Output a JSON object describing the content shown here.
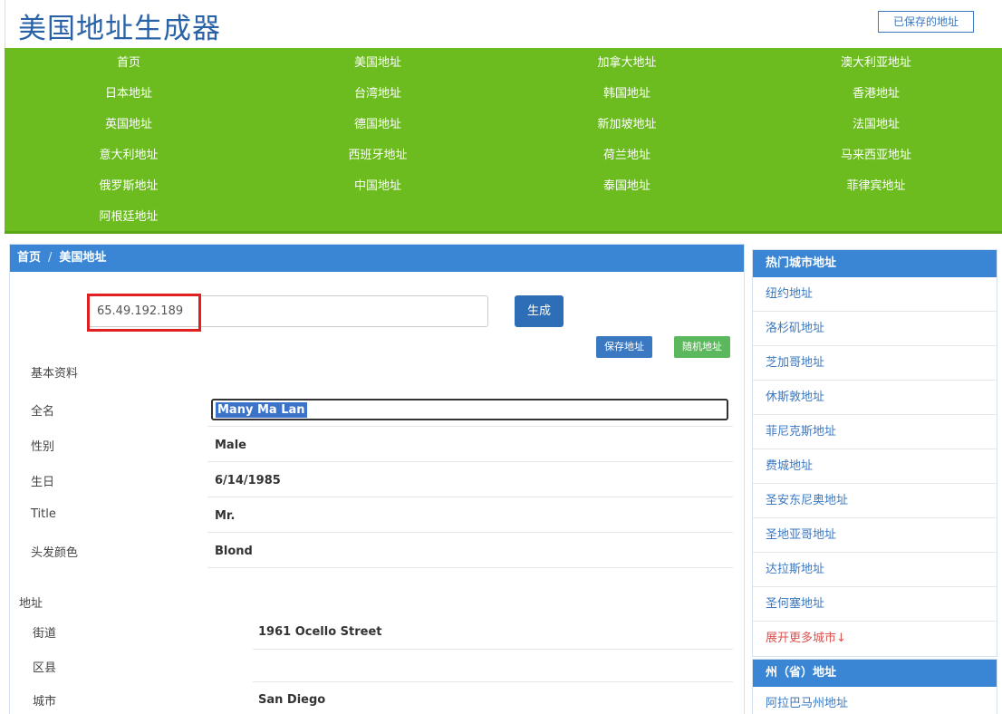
{
  "header": {
    "logo": "美国地址生成器",
    "saved_button": "已保存的地址"
  },
  "nav": [
    [
      "首页",
      "美国地址",
      "加拿大地址",
      "澳大利亚地址"
    ],
    [
      "日本地址",
      "台湾地址",
      "韩国地址",
      "香港地址"
    ],
    [
      "英国地址",
      "德国地址",
      "新加坡地址",
      "法国地址"
    ],
    [
      "意大利地址",
      "西班牙地址",
      "荷兰地址",
      "马来西亚地址"
    ],
    [
      "俄罗斯地址",
      "中国地址",
      "泰国地址",
      "菲律宾地址"
    ],
    [
      "阿根廷地址"
    ]
  ],
  "breadcrumb": {
    "home": "首页",
    "sep": "/",
    "current": "美国地址"
  },
  "ip_input": {
    "value": "65.49.192.189"
  },
  "buttons": {
    "generate": "生成",
    "save_address": "保存地址",
    "random_address": "随机地址"
  },
  "basic_info": {
    "title": "基本资料",
    "rows": [
      {
        "label": "全名",
        "value": "Many Ma Lan"
      },
      {
        "label": "性别",
        "value": "Male"
      },
      {
        "label": "生日",
        "value": "6/14/1985"
      },
      {
        "label": "Title",
        "value": "Mr."
      },
      {
        "label": "头发颜色",
        "value": "Blond"
      }
    ]
  },
  "address": {
    "title": "地址",
    "rows": [
      {
        "label": "街道",
        "value": "1961  Ocello Street"
      },
      {
        "label": "区县",
        "value": ""
      },
      {
        "label": "城市",
        "value": "San Diego"
      }
    ]
  },
  "sidebar": {
    "hot_cities_title": "热门城市地址",
    "hot_cities": [
      "纽约地址",
      "洛杉矶地址",
      "芝加哥地址",
      "休斯敦地址",
      "菲尼克斯地址",
      "费城地址",
      "圣安东尼奥地址",
      "圣地亚哥地址",
      "达拉斯地址",
      "圣何塞地址"
    ],
    "more_cities": "展开更多城市↓",
    "states_title": "州（省）地址",
    "states": [
      "阿拉巴马州地址"
    ]
  }
}
